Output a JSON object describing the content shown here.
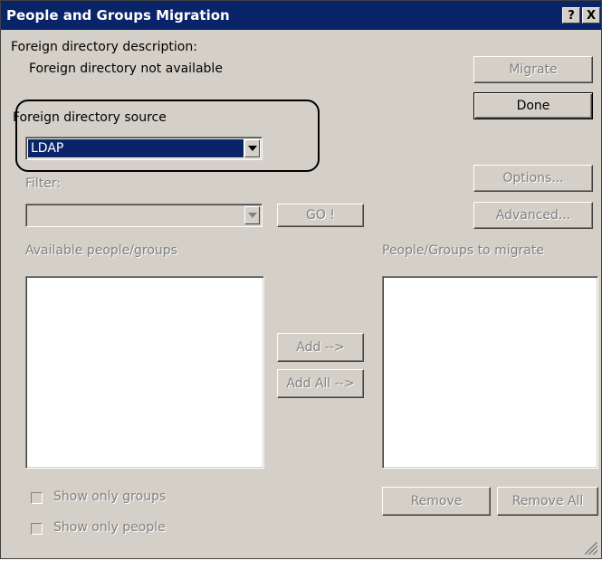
{
  "window": {
    "title": "People and Groups Migration",
    "help_glyph": "?",
    "close_glyph": "X"
  },
  "description": {
    "label": "Foreign directory description:",
    "value": "Foreign directory not available"
  },
  "source": {
    "label": "Foreign directory source",
    "selected": "LDAP"
  },
  "filter": {
    "label": "Filter:",
    "value": "",
    "go_label": "GO !"
  },
  "buttons": {
    "migrate": "Migrate",
    "done": "Done",
    "options": "Options...",
    "advanced": "Advanced...",
    "add": "Add -->",
    "add_all": "Add All -->",
    "remove": "Remove",
    "remove_all": "Remove All"
  },
  "lists": {
    "available_label": "Available people/groups",
    "migrate_label": "People/Groups to migrate"
  },
  "checkboxes": {
    "groups_label": "Show only groups",
    "people_label": "Show only people"
  },
  "colors": {
    "titlebar": "#0a246a",
    "dialog_face": "#d4d0c8",
    "selection": "#0a246a"
  }
}
